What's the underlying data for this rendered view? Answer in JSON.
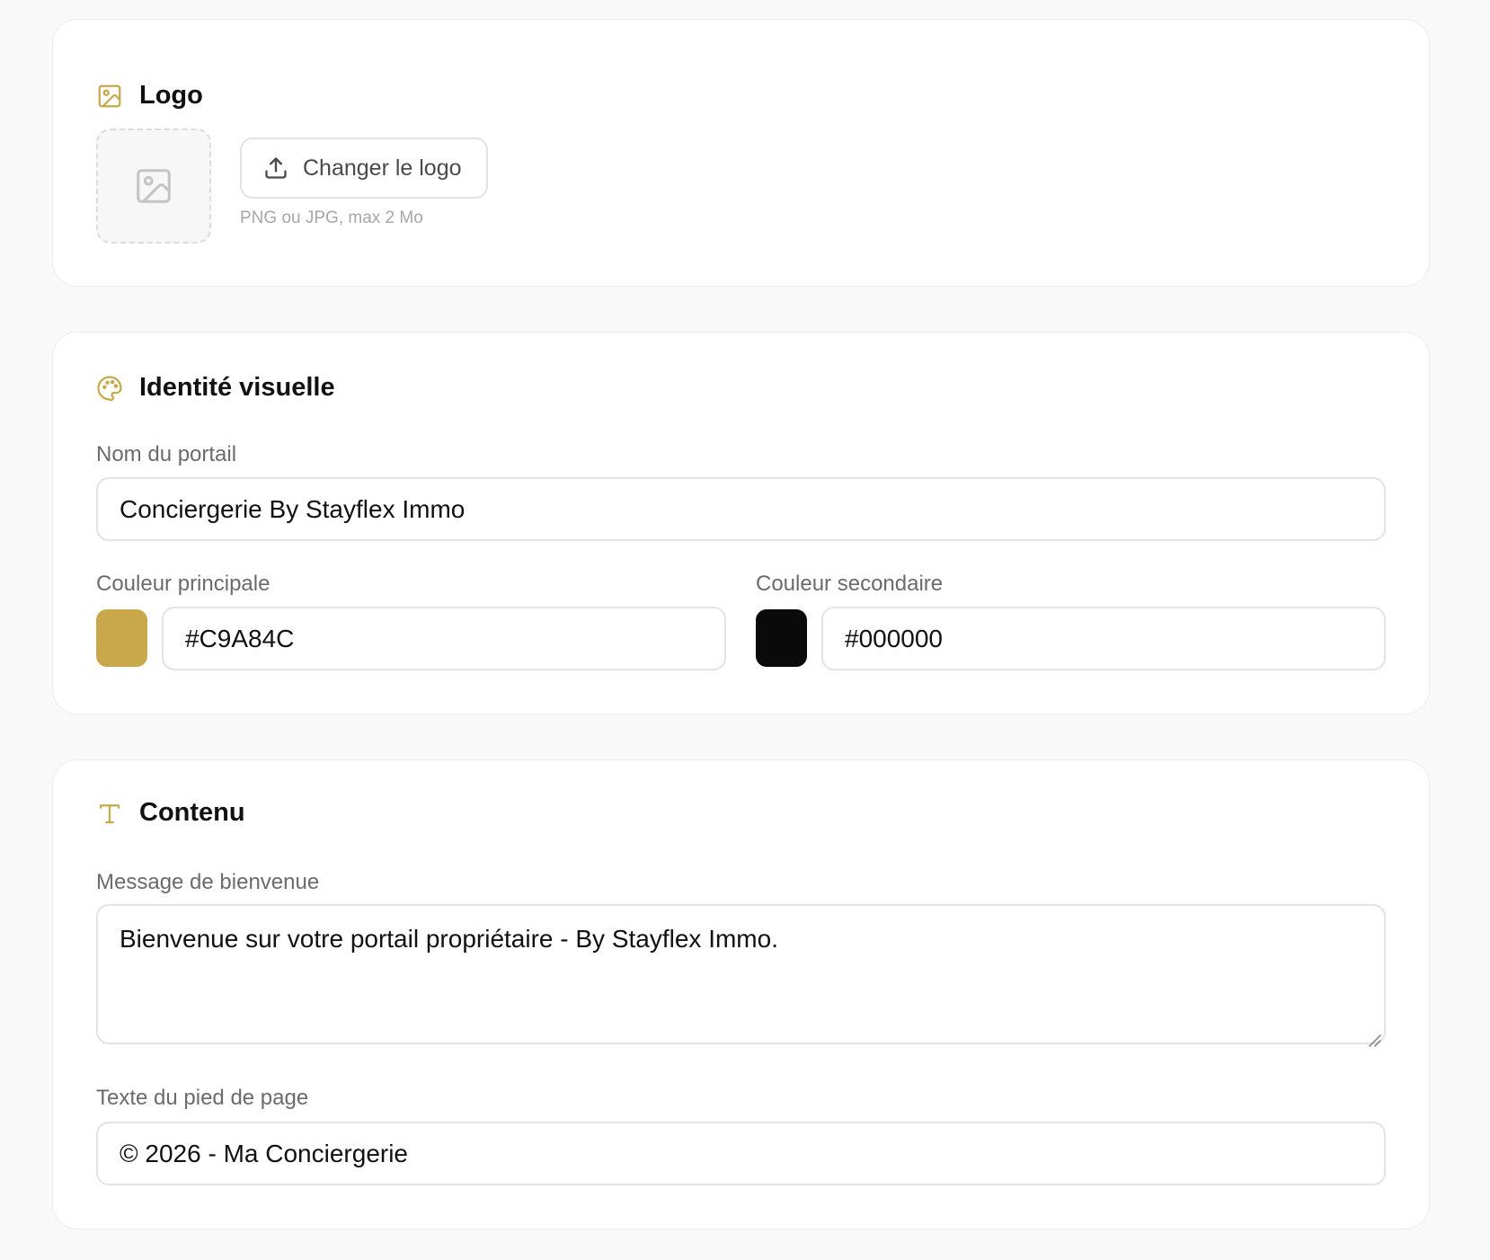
{
  "logo_section": {
    "title": "Logo",
    "icon": "image-icon",
    "placeholder_icon": "image-placeholder-icon",
    "change_button_label": "Changer le logo",
    "change_button_icon": "upload-icon",
    "hint": "PNG ou JPG, max 2 Mo"
  },
  "identity_section": {
    "title": "Identité visuelle",
    "icon": "palette-icon",
    "portal_name_label": "Nom du portail",
    "portal_name_value": "Conciergerie By Stayflex Immo",
    "primary_color_label": "Couleur principale",
    "primary_color_value": "#C9A84C",
    "secondary_color_label": "Couleur secondaire",
    "secondary_color_value": "#000000"
  },
  "content_section": {
    "title": "Contenu",
    "icon": "type-icon",
    "welcome_label": "Message de bienvenue",
    "welcome_value": "Bienvenue sur votre portail propriétaire - By Stayflex Immo.",
    "footer_label": "Texte du pied de page",
    "footer_value": "© 2026 - Ma Conciergerie"
  },
  "colors": {
    "accent": "#C9A84C",
    "secondary_swatch": "#0a0a0a"
  }
}
